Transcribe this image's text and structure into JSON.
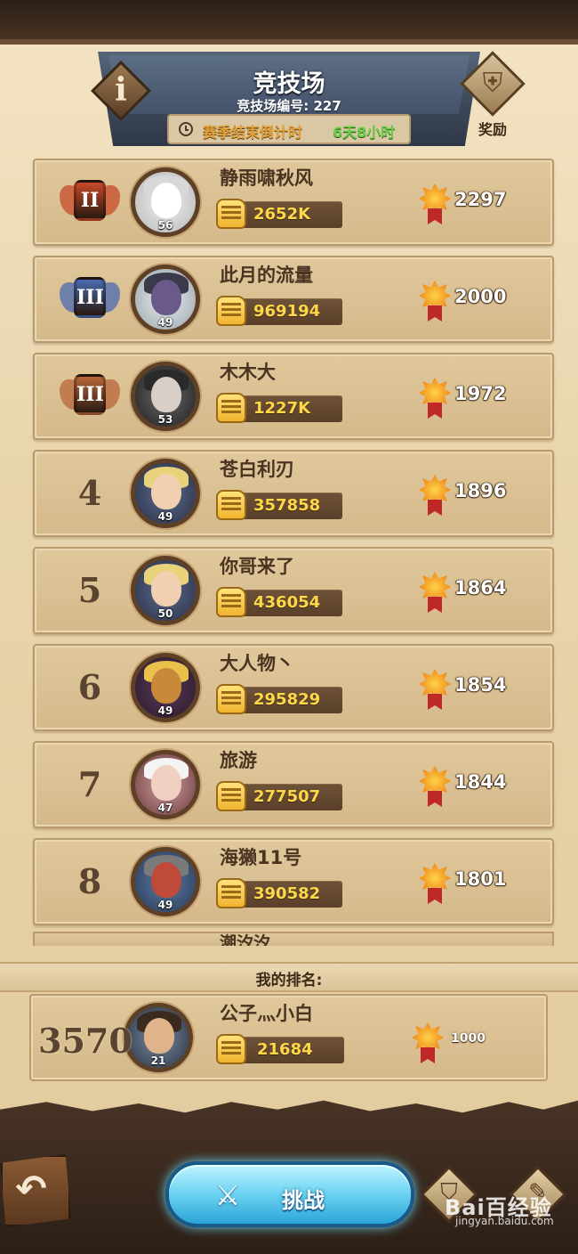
{
  "header": {
    "title": "竞技场",
    "arena_id": "竞技场编号: 227",
    "countdown_label": "赛季结束倒计时",
    "countdown_value": "6天8小时",
    "info_label": "i",
    "reward_label": "奖励"
  },
  "rankings": [
    {
      "rank": "1",
      "medal": "II",
      "medal_color": "#c84a2a",
      "avatar": "white-creature",
      "level": "56",
      "name": "静雨啸秋风",
      "power": "2652K",
      "score": "2297"
    },
    {
      "rank": "2",
      "medal": "III",
      "medal_color": "#4a6ab0",
      "avatar": "meme-image",
      "level": "49",
      "name": "此月的流量",
      "power": "969194",
      "score": "2000"
    },
    {
      "rank": "3",
      "medal": "III",
      "medal_color": "#b8663a",
      "avatar": "fist-photo",
      "level": "53",
      "name": "木木大",
      "power": "1227K",
      "score": "1972"
    },
    {
      "rank": "4",
      "avatar": "winged-hero",
      "level": "49",
      "name": "苍白利刃",
      "power": "357858",
      "score": "1896"
    },
    {
      "rank": "5",
      "avatar": "winged-hero",
      "level": "50",
      "name": "你哥来了",
      "power": "436054",
      "score": "1864"
    },
    {
      "rank": "6",
      "avatar": "horned-warrior",
      "level": "49",
      "name": "大人物丶",
      "power": "295829",
      "score": "1854"
    },
    {
      "rank": "7",
      "avatar": "white-haired-hero",
      "level": "47",
      "name": "旅游",
      "power": "277507",
      "score": "1844"
    },
    {
      "rank": "8",
      "avatar": "bearded-dwarf",
      "level": "49",
      "name": "海獭11号",
      "power": "390582",
      "score": "1801"
    }
  ],
  "partial_row": {
    "name": "潮汐汐"
  },
  "my_rank": {
    "title": "我的排名:",
    "rank": "3570",
    "avatar": "bearded-knight",
    "level": "21",
    "name": "公子灬小白",
    "power": "21684",
    "score": "1000"
  },
  "bottom": {
    "back_icon": "↶",
    "challenge_label": "挑战",
    "swords_icon": "⚔"
  },
  "watermark": {
    "main": "Bai百经验",
    "sub": "jingyan.baidu.com"
  }
}
